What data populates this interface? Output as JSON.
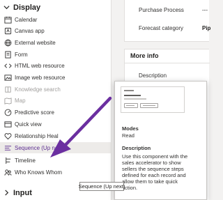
{
  "left_panel": {
    "display_header": "Display",
    "input_header": "Input",
    "items": [
      {
        "label": "Calendar",
        "icon": "calendar-icon",
        "state": "normal"
      },
      {
        "label": "Canvas app",
        "icon": "canvas-app-icon",
        "state": "normal"
      },
      {
        "label": "External website",
        "icon": "globe-icon",
        "state": "normal"
      },
      {
        "label": "Form",
        "icon": "form-icon",
        "state": "normal"
      },
      {
        "label": "HTML web resource",
        "icon": "code-icon",
        "state": "normal"
      },
      {
        "label": "Image web resource",
        "icon": "image-icon",
        "state": "normal"
      },
      {
        "label": "Knowledge search",
        "icon": "knowledge-icon",
        "state": "disabled"
      },
      {
        "label": "Map",
        "icon": "map-icon",
        "state": "disabled"
      },
      {
        "label": "Predictive score",
        "icon": "predictive-score-icon",
        "state": "normal"
      },
      {
        "label": "Quick view",
        "icon": "quick-view-icon",
        "state": "normal"
      },
      {
        "label": "Relationship Heal",
        "icon": "relationship-health-icon",
        "state": "normal"
      },
      {
        "label": "Sequence (Up next)",
        "icon": "sequence-icon",
        "state": "selected"
      },
      {
        "label": "Timeline",
        "icon": "timeline-icon",
        "state": "normal"
      },
      {
        "label": "Who Knows Whom",
        "icon": "who-knows-whom-icon",
        "state": "normal"
      }
    ]
  },
  "form": {
    "purchase_process_label": "Purchase Process",
    "purchase_process_value": "---",
    "forecast_category_label": "Forecast category",
    "forecast_category_value": "Pip",
    "more_info_title": "More info",
    "description_label": "Description"
  },
  "info_card": {
    "modes_heading": "Modes",
    "modes_value": "Read",
    "description_heading": "Description",
    "description_lines": [
      "Use this component with the",
      "sales accelerator to show",
      "sellers the sequence steps",
      "defined for each record and",
      "allow them to take quick",
      "action."
    ]
  },
  "tooltip": {
    "text": "Sequence (Up next)"
  },
  "colors": {
    "accent": "#5c2d91",
    "arrow": "#6b2fa0",
    "disabled_text": "#a19f9d"
  }
}
